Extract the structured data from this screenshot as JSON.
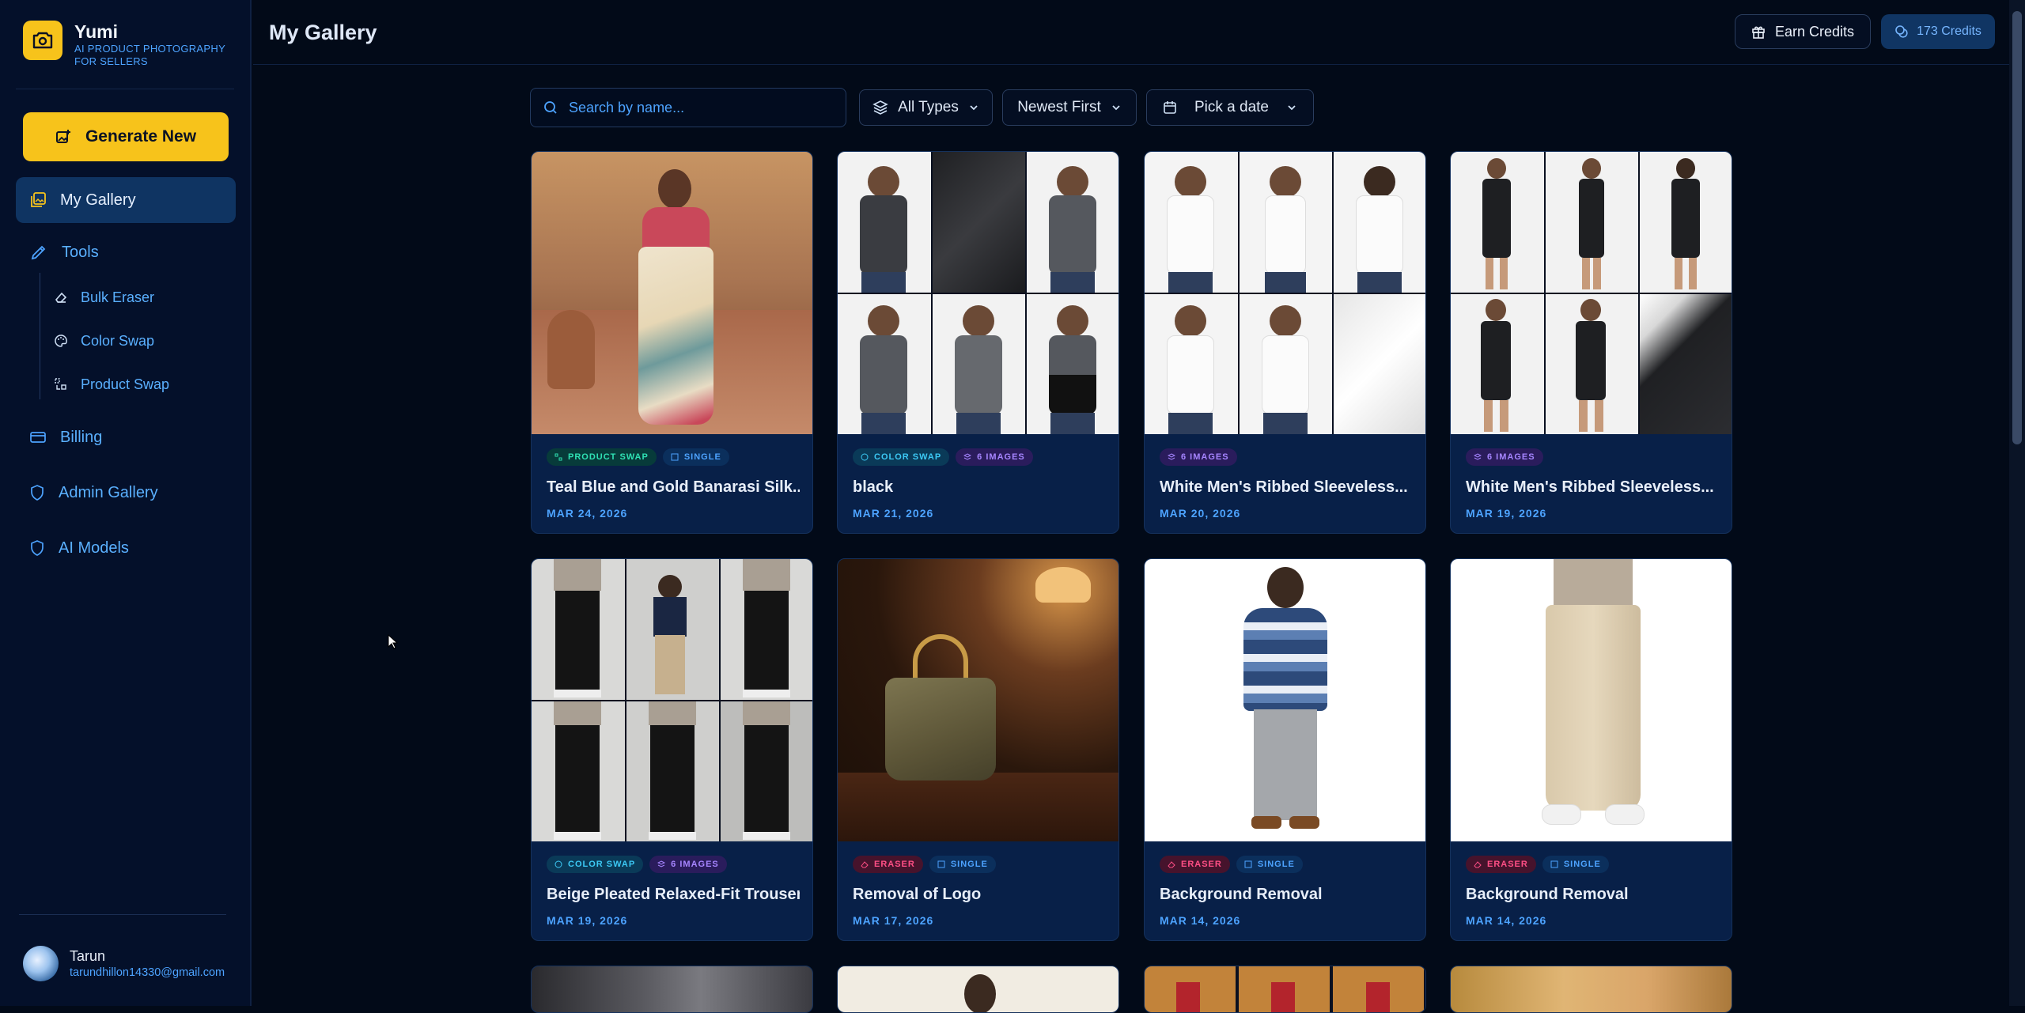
{
  "brand": {
    "name": "Yumi",
    "tagline": "AI PRODUCT PHOTOGRAPHY FOR SELLERS"
  },
  "sidebar": {
    "generate_label": "Generate New",
    "items": [
      {
        "label": "My Gallery",
        "icon": "gallery-icon",
        "active": true
      },
      {
        "label": "Tools",
        "icon": "tools-icon"
      },
      {
        "label": "Bulk Eraser",
        "icon": "eraser-icon"
      },
      {
        "label": "Color Swap",
        "icon": "palette-icon"
      },
      {
        "label": "Product Swap",
        "icon": "swap-icon"
      },
      {
        "label": "Billing",
        "icon": "card-icon"
      },
      {
        "label": "Admin Gallery",
        "icon": "shield-icon"
      },
      {
        "label": "AI Models",
        "icon": "shield-icon"
      }
    ]
  },
  "user": {
    "name": "Tarun",
    "email": "tarundhillon14330@gmail.com"
  },
  "header": {
    "title": "My Gallery",
    "earn_label": "Earn Credits",
    "credits_label": "173 Credits"
  },
  "filters": {
    "search_placeholder": "Search by name...",
    "type_label": "All Types",
    "sort_label": "Newest First",
    "date_label": "Pick a date"
  },
  "cards": [
    {
      "badges": [
        "PRODUCT SWAP",
        "SINGLE"
      ],
      "title": "Teal Blue and Gold Banarasi Silk...",
      "date": "MAR 24, 2026"
    },
    {
      "badges": [
        "COLOR SWAP",
        "6 IMAGES"
      ],
      "title": "black",
      "date": "MAR 21, 2026"
    },
    {
      "badges": [
        "6 IMAGES"
      ],
      "title": "White Men's Ribbed Sleeveless...",
      "date": "MAR 20, 2026"
    },
    {
      "badges": [
        "6 IMAGES"
      ],
      "title": "White Men's Ribbed Sleeveless...",
      "date": "MAR 19, 2026"
    },
    {
      "badges": [
        "COLOR SWAP",
        "6 IMAGES"
      ],
      "title": "Beige Pleated Relaxed-Fit Trousers",
      "date": "MAR 19, 2026"
    },
    {
      "badges": [
        "ERASER",
        "SINGLE"
      ],
      "title": "Removal of Logo",
      "date": "MAR 17, 2026"
    },
    {
      "badges": [
        "ERASER",
        "SINGLE"
      ],
      "title": "Background Removal",
      "date": "MAR 14, 2026"
    },
    {
      "badges": [
        "ERASER",
        "SINGLE"
      ],
      "title": "Background Removal",
      "date": "MAR 14, 2026"
    }
  ],
  "colors": {
    "accent": "#f7c31b",
    "link": "#4da3ff",
    "background": "#020a18",
    "card": "#082048"
  }
}
